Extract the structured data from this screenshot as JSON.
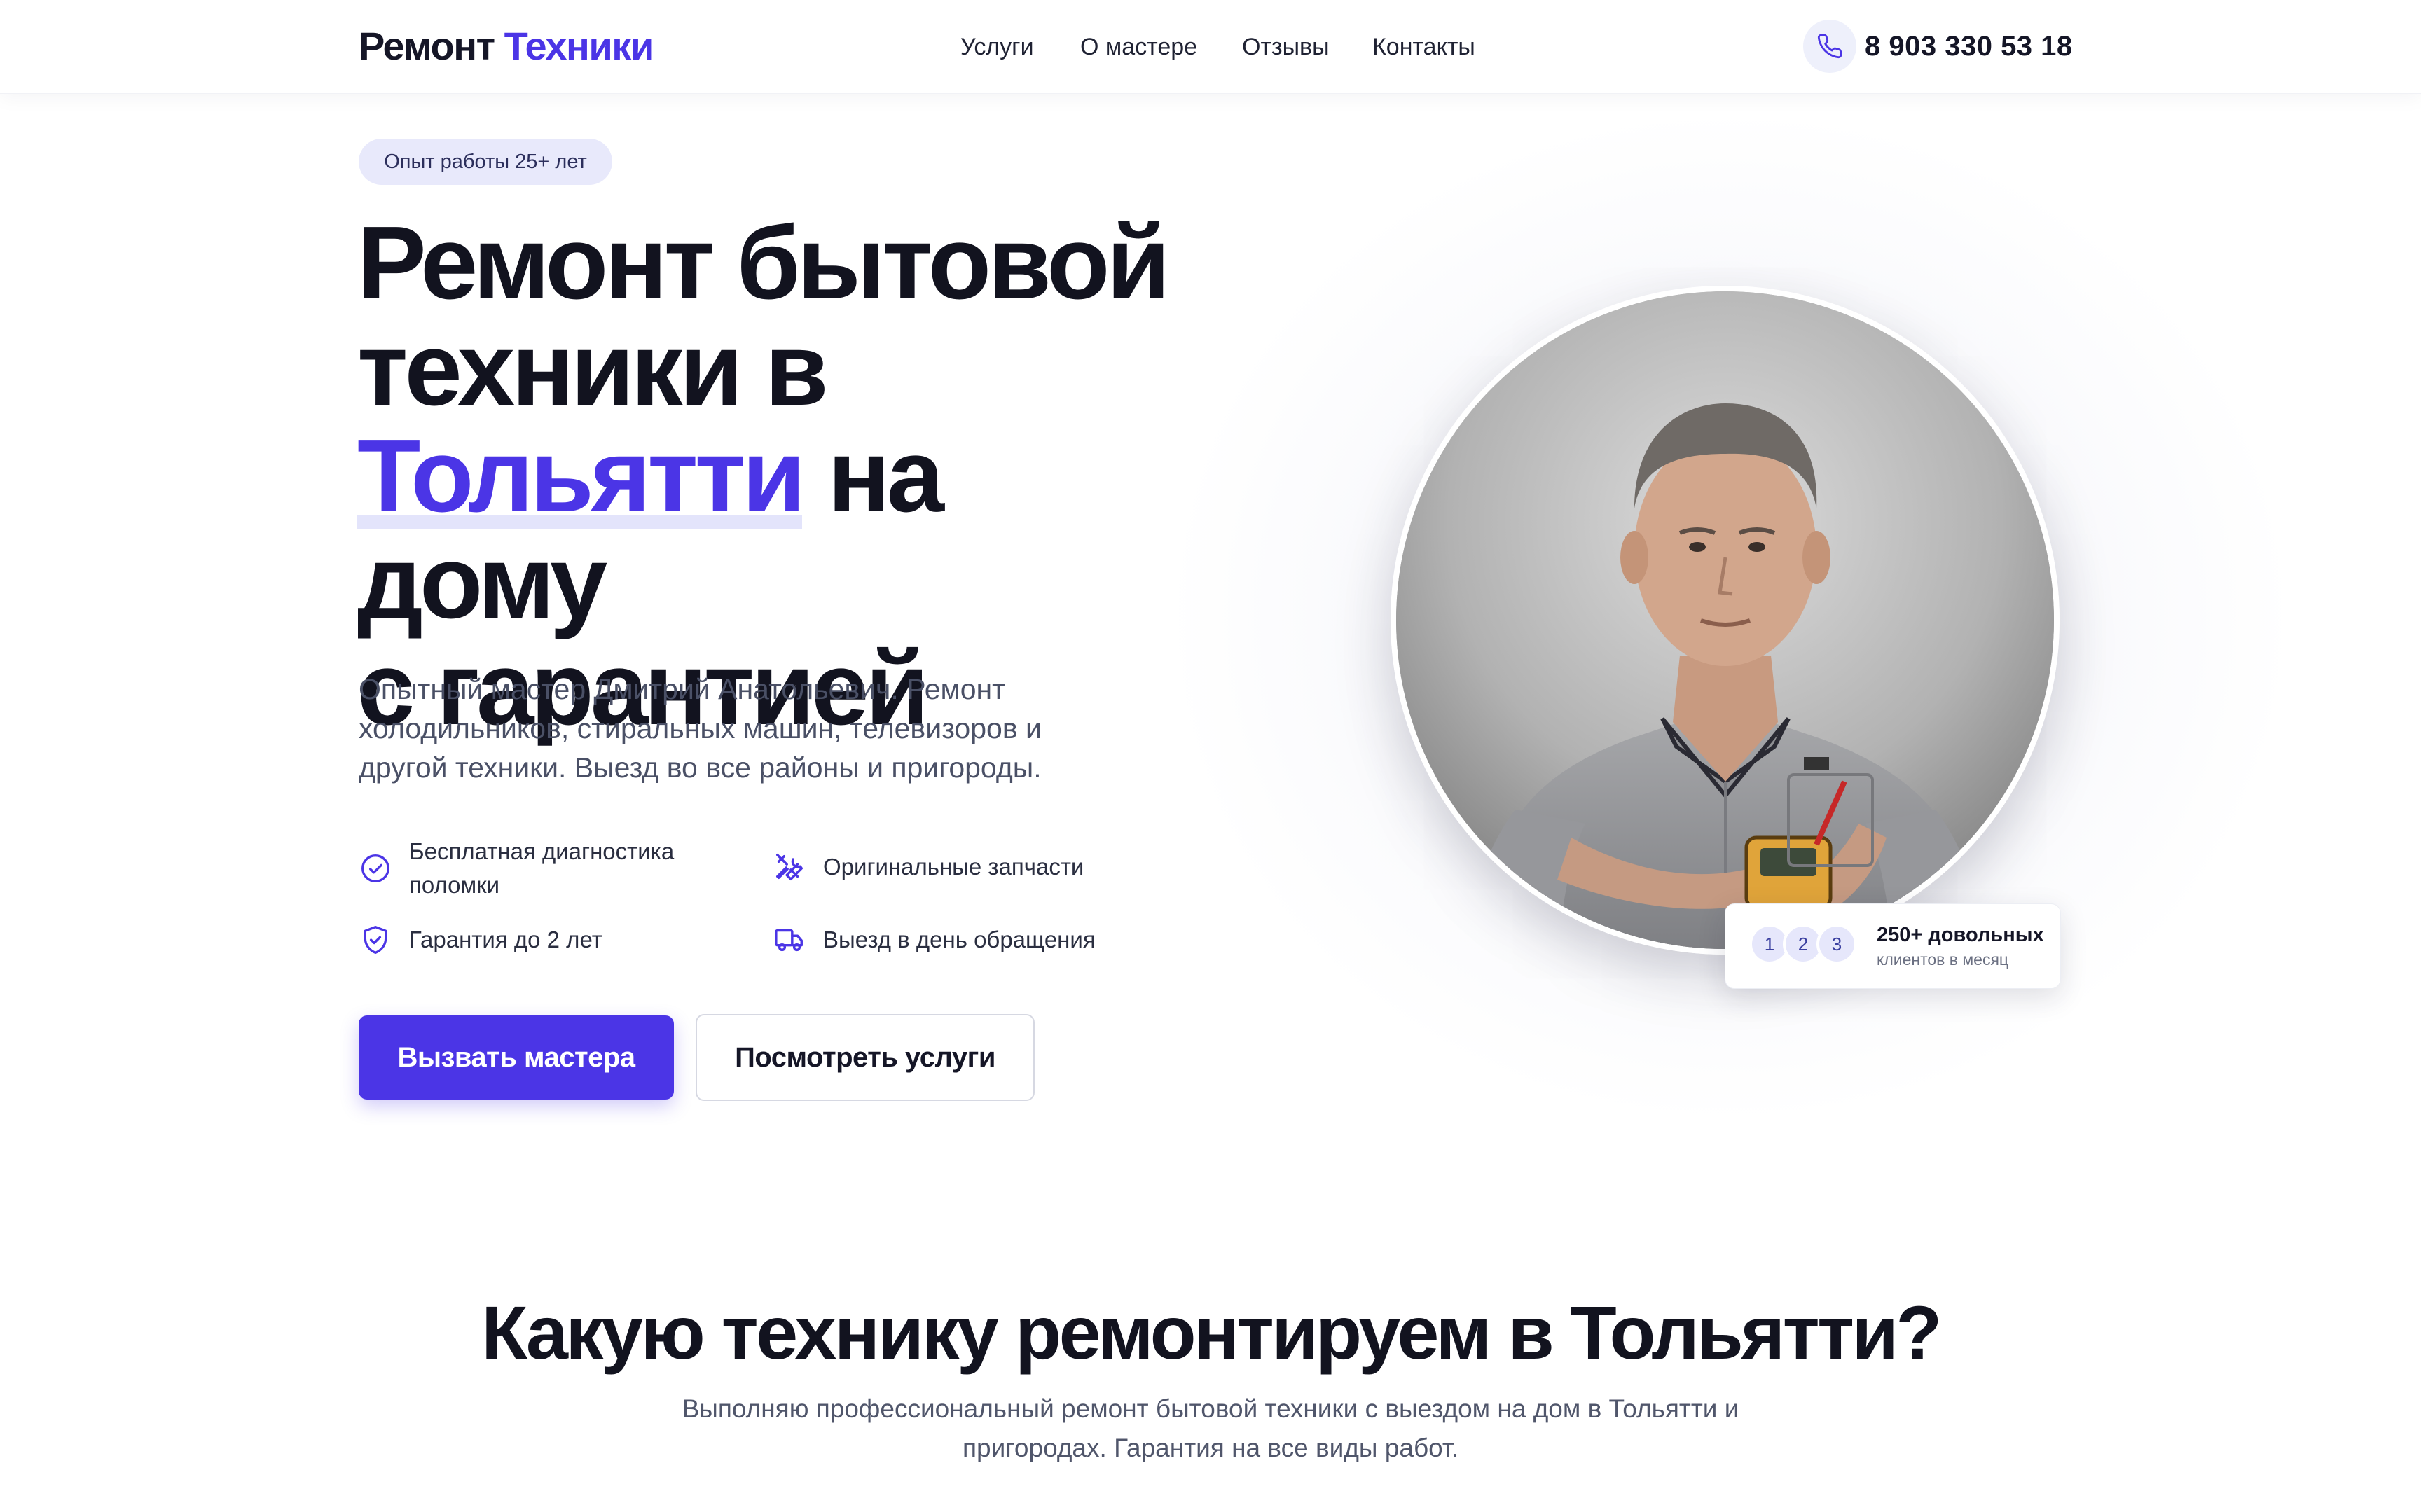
{
  "header": {
    "logo_part1": "Ремонт",
    "logo_part2": "Техники",
    "nav": [
      "Услуги",
      "О мастере",
      "Отзывы",
      "Контакты"
    ],
    "phone": "8 903 330 53 18",
    "phone_icon": "phone-icon"
  },
  "hero": {
    "badge": "Опыт работы 25+ лет",
    "title_line1": "Ремонт бытовой",
    "title_line2": "техники в",
    "title_accent": "Тольятти",
    "title_line3_rest": " на дому",
    "title_line4": "с гарантией",
    "description": "Опытный мастер Дмитрий Анатольевич. Ремонт холодильников, стиральных машин, телевизоров и другой техники. Выезд во все районы и пригороды.",
    "features": [
      {
        "text": "Бесплатная диагностика поломки",
        "icon": "check-circle-icon"
      },
      {
        "text": "Оригинальные запчасти",
        "icon": "tools-icon"
      },
      {
        "text": "Гарантия до 2 лет",
        "icon": "shield-check-icon"
      },
      {
        "text": "Выезд в день обращения",
        "icon": "truck-icon"
      }
    ],
    "primary_button": "Вызвать мастера",
    "secondary_button": "Посмотреть услуги",
    "accent_color": "#4b35e6"
  },
  "stats_card": {
    "avatars": [
      "1",
      "2",
      "3"
    ],
    "title": "250+ довольных",
    "subtitle": "клиентов в месяц"
  },
  "section": {
    "title": "Какую технику ремонтируем в Тольятти?",
    "subtitle": "Выполняю профессиональный ремонт бытовой техники с выездом на дом в Тольятти и пригородах. Гарантия на все виды работ."
  }
}
